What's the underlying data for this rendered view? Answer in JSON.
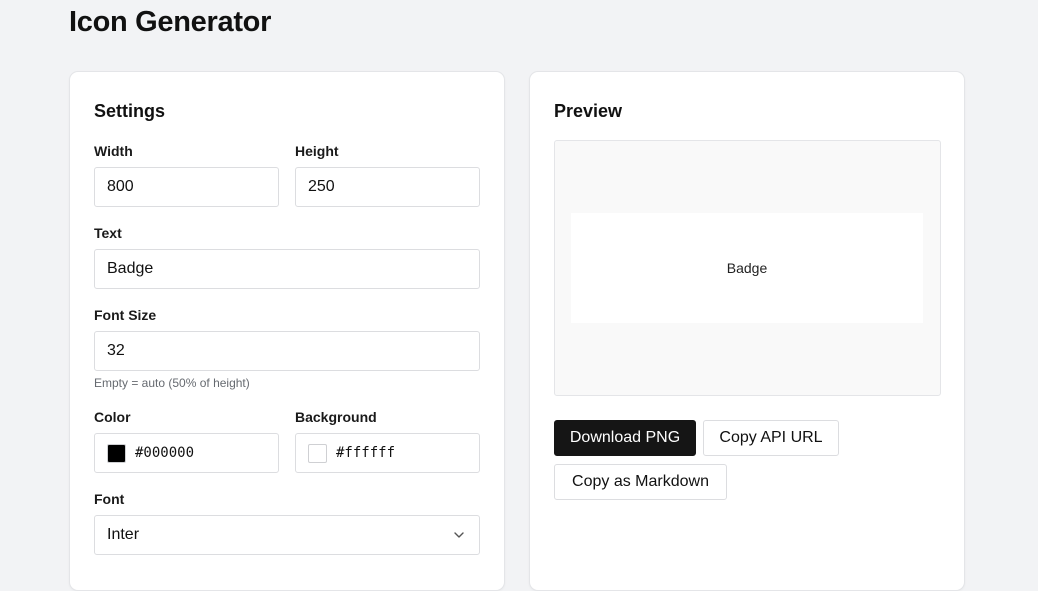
{
  "page": {
    "title": "Icon Generator"
  },
  "settings": {
    "title": "Settings",
    "width": {
      "label": "Width",
      "value": "800"
    },
    "height": {
      "label": "Height",
      "value": "250"
    },
    "text": {
      "label": "Text",
      "value": "Badge"
    },
    "font_size": {
      "label": "Font Size",
      "value": "32",
      "hint": "Empty = auto (50% of height)"
    },
    "color": {
      "label": "Color",
      "value": "#000000",
      "swatch": "#000000"
    },
    "background": {
      "label": "Background",
      "value": "#ffffff",
      "swatch": "#ffffff"
    },
    "font": {
      "label": "Font",
      "selected": "Inter",
      "icon": "chevron-down-icon"
    }
  },
  "preview": {
    "title": "Preview",
    "badge_text": "Badge",
    "buttons": {
      "download": "Download PNG",
      "copy_api": "Copy API URL",
      "copy_markdown": "Copy as Markdown"
    }
  }
}
